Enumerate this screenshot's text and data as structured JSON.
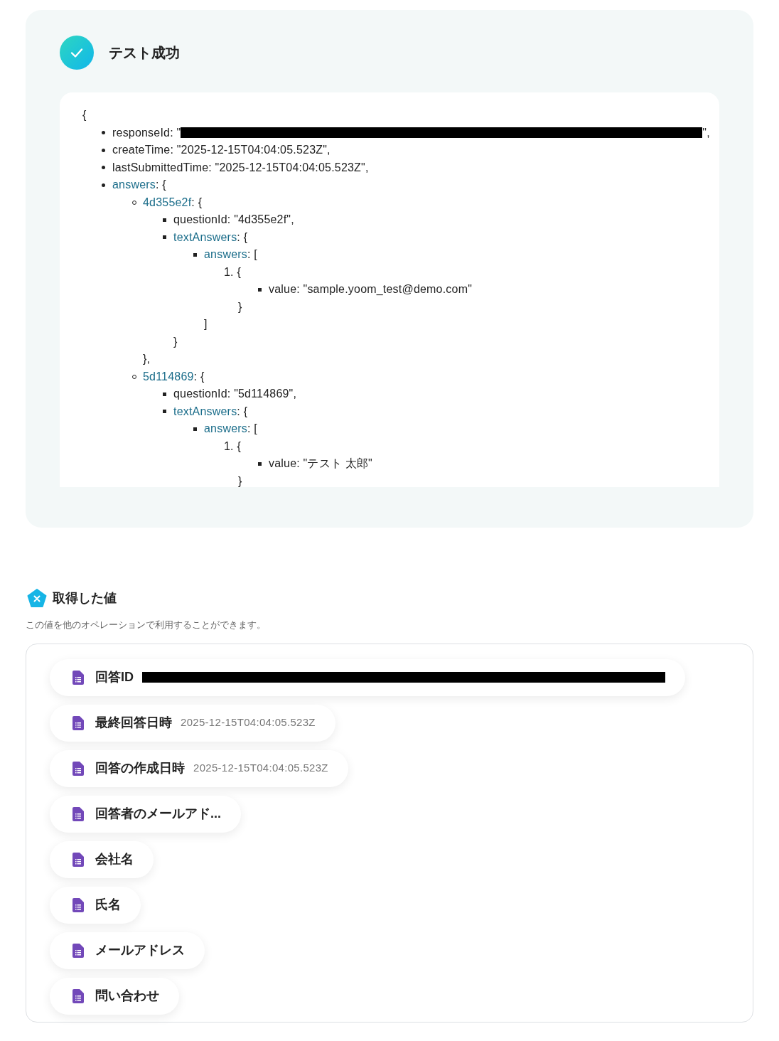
{
  "result": {
    "title": "テスト成功",
    "code": {
      "open": "{",
      "items": [
        {
          "kind": "bullet",
          "key": "responseId",
          "link": false,
          "rest": ": \"",
          "redacted": true,
          "after": "\","
        },
        {
          "kind": "bullet",
          "key": "createTime",
          "link": false,
          "rest": ": \"2025-12-15T04:04:05.523Z\","
        },
        {
          "kind": "bullet",
          "key": "lastSubmittedTime",
          "link": false,
          "rest": ": \"2025-12-15T04:04:05.523Z\","
        },
        {
          "kind": "bullet",
          "key": "answers",
          "link": true,
          "rest": ": {",
          "children": [
            {
              "kind": "bullet",
              "key": "4d355e2f",
              "link": true,
              "rest": ": {",
              "close": "},",
              "children": [
                {
                  "kind": "bullet",
                  "key": "questionId",
                  "link": false,
                  "rest": ": \"4d355e2f\","
                },
                {
                  "kind": "bullet",
                  "key": "textAnswers",
                  "link": true,
                  "rest": ": {",
                  "close": "}",
                  "children": [
                    {
                      "kind": "bullet",
                      "key": "answers",
                      "link": true,
                      "rest": ": [",
                      "close": "]",
                      "children": [
                        {
                          "kind": "ordered",
                          "key": "1.",
                          "rest": " {",
                          "close": "}",
                          "children": [
                            {
                              "kind": "bullet",
                              "key": "value",
                              "link": false,
                              "rest": ": \"sample.yoom_test@demo.com\""
                            }
                          ]
                        }
                      ]
                    }
                  ]
                }
              ]
            },
            {
              "kind": "bullet",
              "key": "5d114869",
              "link": true,
              "rest": ": {",
              "children": [
                {
                  "kind": "bullet",
                  "key": "questionId",
                  "link": false,
                  "rest": ": \"5d114869\","
                },
                {
                  "kind": "bullet",
                  "key": "textAnswers",
                  "link": true,
                  "rest": ": {",
                  "children": [
                    {
                      "kind": "bullet",
                      "key": "answers",
                      "link": true,
                      "rest": ": [",
                      "children": [
                        {
                          "kind": "ordered",
                          "key": "1.",
                          "rest": " {",
                          "close": "}",
                          "children": [
                            {
                              "kind": "bullet",
                              "key": "value",
                              "link": false,
                              "rest": ": \"テスト 太郎\""
                            }
                          ]
                        }
                      ]
                    }
                  ]
                }
              ]
            }
          ]
        }
      ]
    }
  },
  "values": {
    "title": "取得した値",
    "description": "この値を他のオペレーションで利用することができます。",
    "items": [
      {
        "label": "回答ID",
        "redacted": true
      },
      {
        "label": "最終回答日時",
        "value": "2025-12-15T04:04:05.523Z"
      },
      {
        "label": "回答の作成日時",
        "value": "2025-12-15T04:04:05.523Z"
      },
      {
        "label": "回答者のメールアド..."
      },
      {
        "label": "会社名"
      },
      {
        "label": "氏名"
      },
      {
        "label": "メールアドレス"
      },
      {
        "label": "問い合わせ"
      }
    ]
  }
}
